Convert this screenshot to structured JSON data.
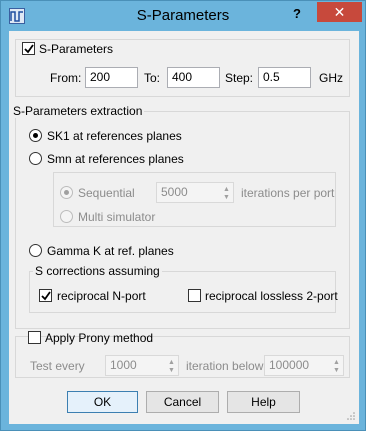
{
  "window": {
    "title": "S-Parameters",
    "help_label": "?",
    "close_label": "✕",
    "app_icon": "waveform-icon"
  },
  "sparams": {
    "checkbox_label": "S-Parameters",
    "checked": true,
    "from_label": "From:",
    "from_value": "200",
    "to_label": "To:",
    "to_value": "400",
    "step_label": "Step:",
    "step_value": "0.5",
    "unit": "GHz"
  },
  "extraction": {
    "group_label": "S-Parameters extraction",
    "options": [
      {
        "label": "SK1 at references planes",
        "selected": true
      },
      {
        "label": "Smn at references planes",
        "selected": false
      },
      {
        "label": "Gamma K at ref. planes",
        "selected": false
      }
    ],
    "smn_options": {
      "sequential_label": "Sequential",
      "sequential_value": "5000",
      "iterations_label": "iterations per port",
      "multi_label": "Multi simulator"
    },
    "corrections": {
      "group_label": "S corrections assuming",
      "reciprocal_label": "reciprocal N-port",
      "reciprocal_checked": true,
      "lossless_label": "reciprocal lossless 2-port",
      "lossless_checked": false
    }
  },
  "prony": {
    "checkbox_label": "Apply Prony method",
    "checked": false,
    "test_every_label": "Test every",
    "test_every_value": "1000",
    "iteration_below_label": "iteration below",
    "iteration_below_value": "100000"
  },
  "buttons": {
    "ok": "OK",
    "cancel": "Cancel",
    "help": "Help"
  }
}
